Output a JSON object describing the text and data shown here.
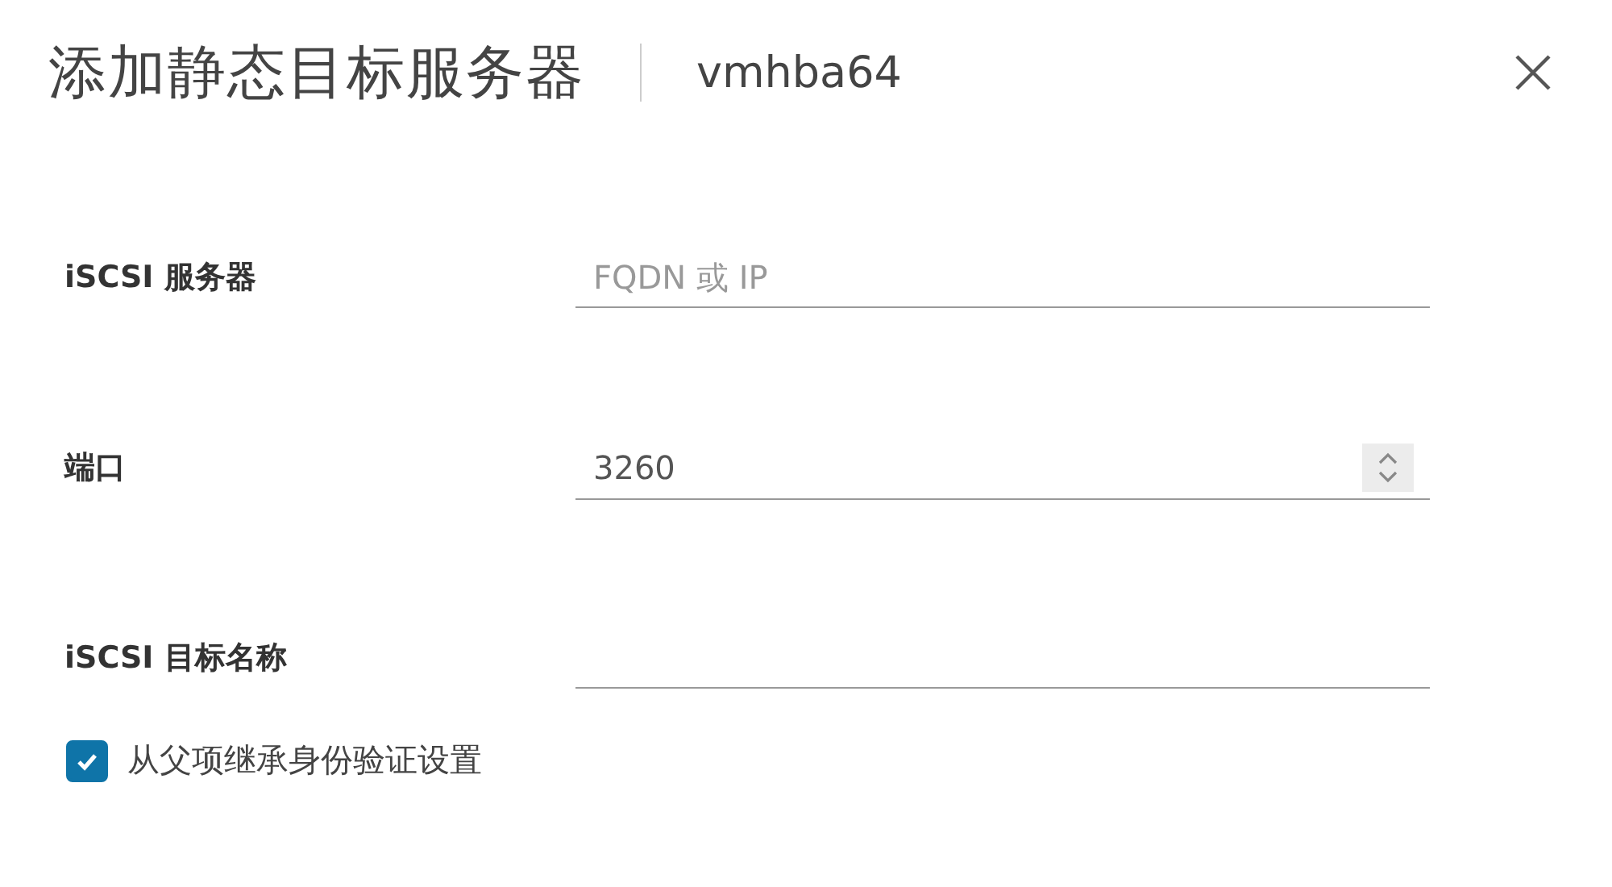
{
  "dialog": {
    "title": "添加静态目标服务器",
    "subtitle": "vmhba64"
  },
  "fields": [
    {
      "label": "iSCSI 服务器",
      "kind": "text",
      "placeholder": "FQDN 或 IP"
    },
    {
      "label": "端口",
      "kind": "number",
      "value": "3260"
    },
    {
      "label": "iSCSI 目标名称",
      "kind": "text"
    }
  ],
  "checkbox": {
    "label": "从父项继承身份验证设置",
    "checked": true
  }
}
